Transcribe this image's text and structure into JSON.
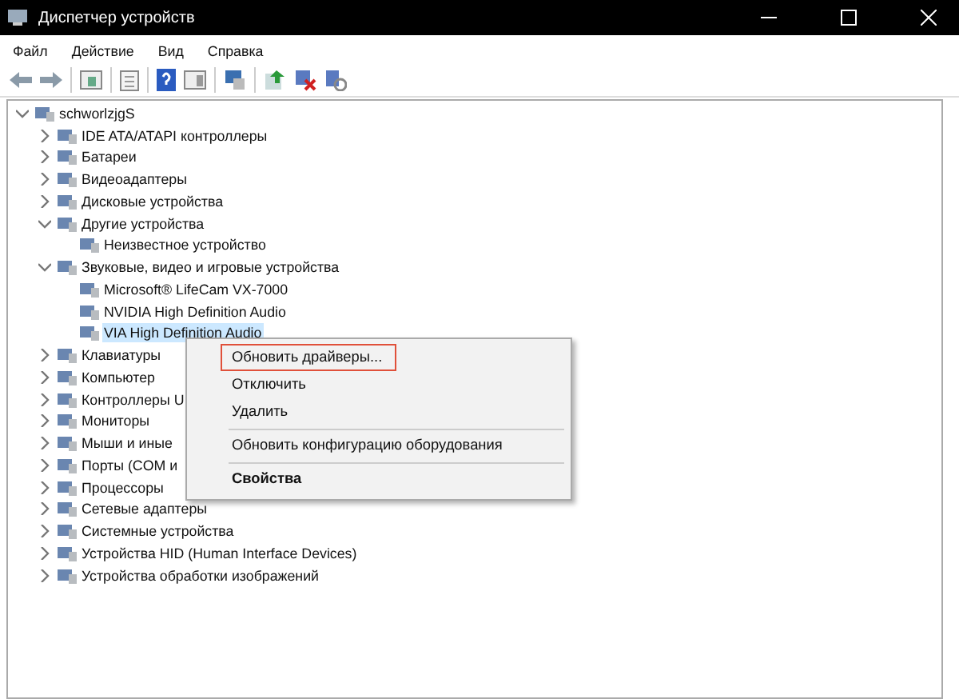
{
  "window": {
    "title": "Диспетчер устройств"
  },
  "menu": [
    {
      "label": "Файл"
    },
    {
      "label": "Действие"
    },
    {
      "label": "Вид"
    },
    {
      "label": "Справка"
    }
  ],
  "tree": [
    {
      "label": "schworlzjgS",
      "expanded": true,
      "selected": false,
      "children": [
        {
          "label": "IDE ATA/ATAPI контроллеры",
          "expanded": false,
          "selected": false
        },
        {
          "label": "Батареи",
          "expanded": false,
          "selected": false
        },
        {
          "label": "Видеоадаптеры",
          "expanded": false,
          "selected": false
        },
        {
          "label": "Дисковые устройства",
          "expanded": false,
          "selected": false
        },
        {
          "label": "Другие устройства",
          "expanded": true,
          "selected": false,
          "children": [
            {
              "label": "Неизвестное устройство",
              "selected": false
            }
          ]
        },
        {
          "label": "Звуковые, видео и игровые устройства",
          "expanded": true,
          "selected": false,
          "children": [
            {
              "label": "Microsoft® LifeCam VX-7000",
              "selected": false
            },
            {
              "label": "NVIDIA High Definition Audio",
              "selected": false
            },
            {
              "label": "VIA High Definition Audio",
              "selected": true
            }
          ]
        },
        {
          "label": "Клавиатуры",
          "expanded": false,
          "selected": false
        },
        {
          "label": "Компьютер",
          "expanded": false,
          "selected": false
        },
        {
          "label": "Контроллеры U",
          "expanded": false,
          "selected": false
        },
        {
          "label": "Мониторы",
          "expanded": false,
          "selected": false
        },
        {
          "label": "Мыши и иные",
          "expanded": false,
          "selected": false
        },
        {
          "label": "Порты (COM и",
          "expanded": false,
          "selected": false
        },
        {
          "label": "Процессоры",
          "expanded": false,
          "selected": false
        },
        {
          "label": "Сетевые адаптеры",
          "expanded": false,
          "selected": false
        },
        {
          "label": "Системные устройства",
          "expanded": false,
          "selected": false
        },
        {
          "label": "Устройства HID (Human Interface Devices)",
          "expanded": false,
          "selected": false
        },
        {
          "label": "Устройства обработки изображений",
          "expanded": false,
          "selected": false
        }
      ]
    }
  ],
  "context_menu": [
    {
      "kind": "item",
      "label": "Обновить драйверы...",
      "selected": true,
      "bold": false
    },
    {
      "kind": "item",
      "label": "Отключить",
      "selected": false,
      "bold": false
    },
    {
      "kind": "item",
      "label": "Удалить",
      "selected": false,
      "bold": false
    },
    {
      "kind": "separator"
    },
    {
      "kind": "item",
      "label": "Обновить конфигурацию оборудования",
      "selected": false,
      "bold": false
    },
    {
      "kind": "separator"
    },
    {
      "kind": "item",
      "label": "Свойства",
      "selected": false,
      "bold": true
    }
  ]
}
